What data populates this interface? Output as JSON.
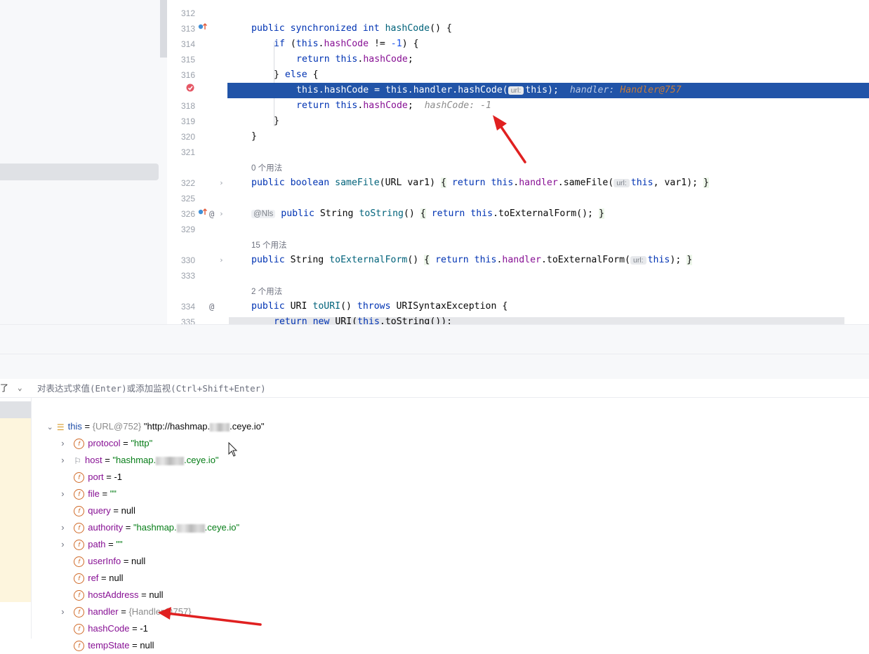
{
  "editor": {
    "lines": [
      {
        "num": "312"
      },
      {
        "num": "313"
      },
      {
        "num": "314"
      },
      {
        "num": "315"
      },
      {
        "num": "316"
      },
      {
        "num": ""
      },
      {
        "num": "318"
      },
      {
        "num": "319"
      },
      {
        "num": "320"
      },
      {
        "num": "321"
      },
      {
        "num": "322"
      },
      {
        "num": "325"
      },
      {
        "num": "326"
      },
      {
        "num": "329"
      },
      {
        "num": "330"
      },
      {
        "num": "333"
      },
      {
        "num": "334"
      },
      {
        "num": "335"
      }
    ],
    "code": {
      "l313_kw1": "public",
      "l313_kw2": "synchronized",
      "l313_kw3": "int",
      "l313_fn": "hashCode",
      "l313_rest": "() {",
      "l314_kw": "if",
      "l314_a": " (",
      "l314_this": "this",
      "l314_dot": ".",
      "l314_fld": "hashCode",
      "l314_b": " != ",
      "l314_num": "-1",
      "l314_c": ") {",
      "l315_kw": "return",
      "l315_this": "this",
      "l315_dot": ".",
      "l315_fld": "hashCode",
      "l315_end": ";",
      "l316_a": "} ",
      "l316_kw": "else",
      "l316_b": " {",
      "l317_a": "this.hashCode = this.handler.hashCode(",
      "l317_hint": "url:",
      "l317_b": "this);",
      "l317_inline_name": "handler:",
      "l317_inline_val": "Handler@757",
      "l318_kw": "return",
      "l318_this": "this",
      "l318_dot": ".",
      "l318_fld": "hashCode",
      "l318_end": ";",
      "l318_inline": "hashCode: -1",
      "l319": "}",
      "l320": "}",
      "usage_322": "0 个用法",
      "l322_kw1": "public",
      "l322_kw2": "boolean",
      "l322_fn": "sameFile",
      "l322_a": "(URL var1) ",
      "l322_ob": "{",
      "l322_kw3": "return",
      "l322_this": "this",
      "l322_dot": ".",
      "l322_fld": "handler",
      "l322_b": ".sameFile(",
      "l322_hint": "url:",
      "l322_this2": "this",
      "l322_c": ", var1);",
      "l322_cb": "}",
      "l326_anno": "@Nls",
      "l326_kw1": "public",
      "l326_type": "String",
      "l326_fn": "toString",
      "l326_a": "() ",
      "l326_ob": "{",
      "l326_kw2": "return",
      "l326_this": "this",
      "l326_b": ".toExternalForm();",
      "l326_cb": "}",
      "usage_330": "15 个用法",
      "l330_kw1": "public",
      "l330_type": "String",
      "l330_fn": "toExternalForm",
      "l330_a": "() ",
      "l330_ob": "{",
      "l330_kw2": "return",
      "l330_this": "this",
      "l330_dot": ".",
      "l330_fld": "handler",
      "l330_b": ".toExternalForm(",
      "l330_hint": "url:",
      "l330_this2": "this",
      "l330_c": ");",
      "l330_cb": "}",
      "usage_334": "2 个用法",
      "l334_kw1": "public",
      "l334_type": "URI",
      "l334_fn": "toURI",
      "l334_a": "() ",
      "l334_kw2": "throws",
      "l334_b": " URISyntaxException {",
      "l335_kw1": "return",
      "l335_kw2": "new",
      "l335_a": " URI(",
      "l335_this": "this",
      "l335_b": ".toString());"
    }
  },
  "debugger": {
    "frames_label_tail": "了",
    "eval_placeholder": "对表达式求值(Enter)或添加监视(Ctrl+Shift+Enter)",
    "root": {
      "name": "this",
      "eq": " = ",
      "type": "{URL@752}",
      "value_pre": " \"http://hashmap.",
      "value_post": ".ceye.io\""
    },
    "fields": [
      {
        "name": "protocol",
        "eq": " = ",
        "value": "\"http\""
      },
      {
        "name": "host",
        "eq": " = ",
        "value_pre": "\"hashmap.",
        "value_post": ".ceye.io\""
      },
      {
        "name": "port",
        "eq": " = ",
        "value": "-1"
      },
      {
        "name": "file",
        "eq": " = ",
        "value": "\"\""
      },
      {
        "name": "query",
        "eq": " = ",
        "value": "null"
      },
      {
        "name": "authority",
        "eq": " = ",
        "value_pre": "\"hashmap.",
        "value_post": ".ceye.io\""
      },
      {
        "name": "path",
        "eq": " = ",
        "value": "\"\""
      },
      {
        "name": "userInfo",
        "eq": " = ",
        "value": "null"
      },
      {
        "name": "ref",
        "eq": " = ",
        "value": "null"
      },
      {
        "name": "hostAddress",
        "eq": " = ",
        "value": "null"
      },
      {
        "name": "handler",
        "eq": " = ",
        "value": "{Handler@757}"
      },
      {
        "name": "hashCode",
        "eq": " = ",
        "value": "-1"
      },
      {
        "name": "tempState",
        "eq": " = ",
        "value": "null"
      }
    ],
    "field_icon": "f"
  },
  "colors": {
    "accent_selection": "#2154a8",
    "annotation_arrow": "#e02020"
  }
}
